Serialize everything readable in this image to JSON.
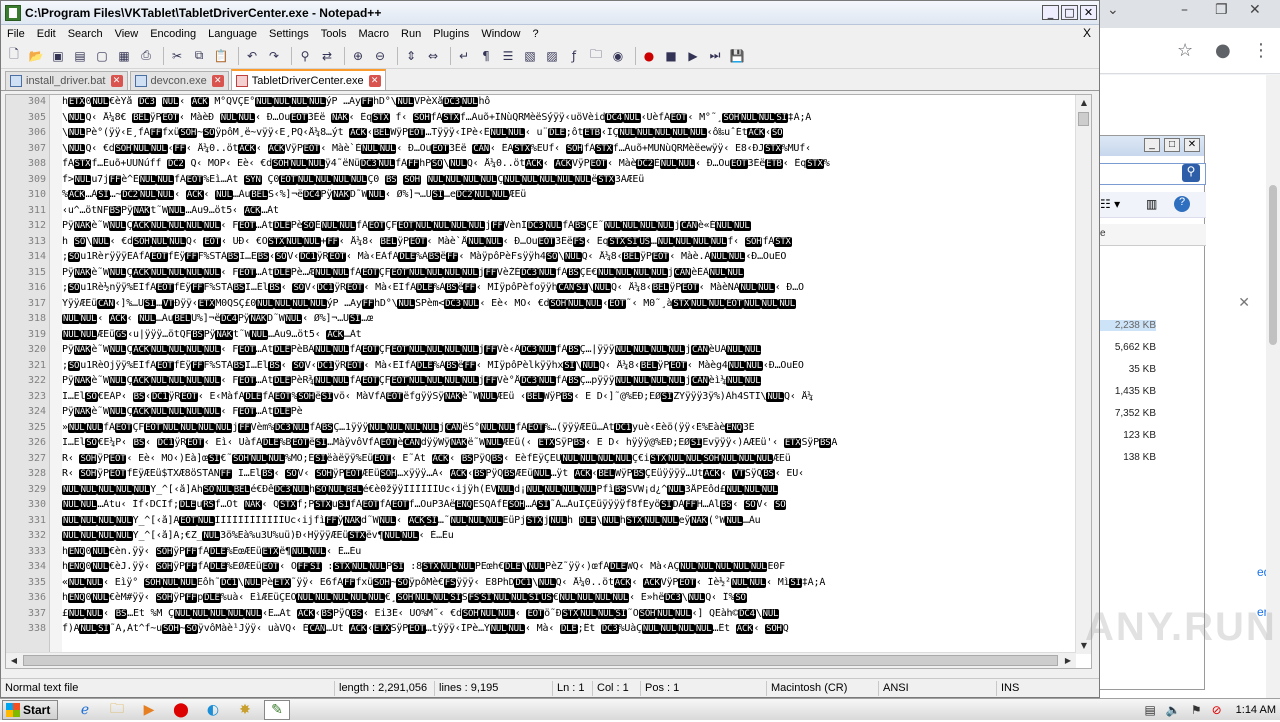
{
  "window": {
    "title": "C:\\Program Files\\VKTablet\\TabletDriverCenter.exe - Notepad++",
    "min": "_",
    "max": "□",
    "close": "✕"
  },
  "menu": [
    "File",
    "Edit",
    "Search",
    "View",
    "Encoding",
    "Language",
    "Settings",
    "Tools",
    "Macro",
    "Run",
    "Plugins",
    "Window",
    "?"
  ],
  "menu_close": "X",
  "toolbar_icons": [
    "new-file-icon",
    "open-file-icon",
    "save-icon",
    "save-all-icon",
    "close-icon",
    "close-all-icon",
    "print-icon",
    "cut-icon",
    "copy-icon",
    "paste-icon",
    "undo-icon",
    "redo-icon",
    "find-icon",
    "replace-icon",
    "zoom-in-icon",
    "zoom-out-icon",
    "sync-v-icon",
    "sync-h-icon",
    "wrap-icon",
    "show-all-icon",
    "indent-guide-icon",
    "udl-icon",
    "doc-map-icon",
    "function-list-icon",
    "folder-workspace-icon",
    "monitor-icon",
    "record-macro-icon",
    "stop-record-icon",
    "play-macro-icon",
    "run-macro-multiple-icon",
    "save-macro-icon"
  ],
  "tabs": [
    {
      "label": "install_driver.bat",
      "active": false
    },
    {
      "label": "devcon.exe",
      "active": false
    },
    {
      "label": "TabletDriverCenter.exe",
      "active": true
    }
  ],
  "editor": {
    "lines": [
      {
        "n": "304",
        "t": "hETX0NUL€èYå DC3 NUL‹ ACK M°QVÇE°NULNULNULNULýP  …ÄyFFhD°\\NULVPèXåDC3NULhô"
      },
      {
        "n": "305",
        "t": "\\NULQ‹ Å¼8€ BELÿPEOT‹ MàèÐ NULNUL‹ Ð…ÒuEOT3Éë NAK‹ ÊqSTX f‹ SOHfÀSTXf…Àuõ+ÎÑùQRMèëSýÿÿ‹uöVèidDC4NUL‹UèfÁEOT‹ M°˜¸SOHNULNULSI‡À;Á"
      },
      {
        "n": "306",
        "t": "\\NULPè°(ÿÿ‹E¸fÀFFfxüSOH~SOÿpôM¸ë~vÿÿ‹E¸PQ‹Å¼8…ýt ACK‹BELWÿPEOT…Tÿÿÿ‹ÌPè‹ÊNULNUL‹ u¨DLE;ôtETB‹ÎÇNULNULNULNULNUL‹ô‰uˆÉtACK‹SO"
      },
      {
        "n": "307",
        "t": "\\NULQ‹ €dSOHNULNUL‹FF‹ Å¼0..ötACK‹ ACKVÿPEOT‹ Màè`ÈNULNUL‹ Ð…ÒuEOT3Éë CAN‹ ÊASTX%EÜf‹ SOHfÀSTXf…Àuõ+MÜÑùQRMèëewÿÿ‹ E8‹ÐJSTX%MÜf‹"
      },
      {
        "n": "308",
        "t": "fÀSTXf…Éuõ+UÜÑúff DC2 Q‹ MÒP‹ Eè‹ €dSOHNULNULÿ4˜ëÑüDC3NULfÀFFhPSO\\NULQ‹ Å¼0..ötACK‹ ACKVÿPEOT‹ MàèDC2ÈNULNUL‹ Ð…ÒuEOT3ÉëETB‹ ÊqSTX%"
      },
      {
        "n": "309",
        "t": "f>NULu7jFFè^ÈNULNULfÀEOT%Eì…Àt SYN Ç0EOTNULNULNULNULÇ0 BS SOH NULNULNULNULÇNULNULNULNULNULëSTX3ÀÆEü"
      },
      {
        "n": "310",
        "t": "%ACK…ÀSI…~DC2NULNUL‹ ACK‹ NUL…ÀuBELS‹%]¬ëDC4PÿNAKD˜WNUL‹ Ø%]¬…ÜSI…eDC2NULNULÆEü"
      },
      {
        "n": "311",
        "t": "‹u^…ötNFBSPÿNAKt˜WNUL…Àu9…öt5‹ ACK…Àt"
      },
      {
        "n": "312",
        "t": "PÿNAKè˜WNULÇACKNULNULNULNUL‹ FEOT…ÀtDLEPèSOÉNULNULfÀEOTÇFEOTNULNULNULNULjFFVènÍDC3NULfÀBSÇE˜NULNULNULNULjCANè«ÉNULNUL"
      },
      {
        "n": "313",
        "t": "h SO\\NUL‹ €dSOHNULNULQ‹ EOT‹ UÐ‹ €ÔSTXNULNUL+FF‹ Å¼8‹ BELÿPEOT‹ Màè`ÅNULNUL‹ Ð…ÒuEOT3ÉëFS‹ ÊqSTXSIUS…NULNULNULNULf‹ SOHfÀSTX"
      },
      {
        "n": "314",
        "t": ";SOu1RèrÿÿÿEÀfÀEOTfÉÿFFF%STÀBSI…ËBS‹SOV‹DC1ÿREOT‹ Mà‹EÀfÀDLE%ÀBSëFF‹ MàÿpôPèFsÿÿh4SO\\NULQ‹ Å¼8‹BELÿPEOT‹ Màè.ÀNULNUL‹Ð…ÒuEO"
      },
      {
        "n": "315",
        "t": "PÿNAKè˜WNULÇACKNULNULNULNUL‹ FEOT…ÀtDLEPè…ÆNULNULfÀEOTÇFEOTNULNULNULNULjFFVèŽÉDC3NULfÀBSÇE€NULNULNULNULjCANèÈÂNULNUL"
      },
      {
        "n": "316",
        "t": ";SOu1Rè½nÿÿ%EÌfÀEOTfÉÿFFF%STÀBSI…ÉlBS‹ SOV‹DC1ÿREOT‹ Mà‹EÌfÀDLE%ÀBSëFF‹ MÌÿpôPèfoÿÿhCANSI\\NULQ‹ Å¼8‹BELÿPEOT‹ MàèNÀNULNUL‹ Ð…Ò"
      },
      {
        "n": "317",
        "t": "ŸÿÿÆEüCAN‹]%…ÜSI…VTÐÿÿ‹ETXM0QSÇ£0NULNULNULNULýP  …ÄyFFhD°\\NULSPèm<DC3NUL‹ Eè‹ MÔ‹ €dSOHNULNUL‹EOT˜‹ M0˜¸àSTXNULNULEOTNULNULNUL"
      },
      {
        "n": "318",
        "t": "NULNUL‹ ACK‹ NUL…ÀuBELÛ%]¬ëDC4PÿNAKD˜WNUL‹ Ø%]¬…ÜSI…œ"
      },
      {
        "n": "319",
        "t": "NULNULÆEüGS‹u|ÿÿÿ…ötQFBSPÿNAKt˜WNUL…Àu9…öt5‹ ACK…Àt"
      },
      {
        "n": "320",
        "t": "PÿNAKè˜WNULÇACKNULNULNULNUL‹ FEOT…ÀtDLEPèBÂNULNULfÀEOTÇFEOTNULNULNULNULjFFVè‹ÂDC3NULfÀBSÇ…|ÿÿÿNULNULNULNULjCANèUÁNULNUL"
      },
      {
        "n": "321",
        "t": ";SOu1RèOjÿÿ%EÌfÀEOTfÉÿFFF%STÀBSI…ÉlBS‹ SOV‹DC1ÿREOT‹ Mà‹EÌfÀDLE%ÀBSëFF‹ MÌÿpôPèlkÿÿhxSI\\NULQ‹ Å¼8‹BELÿPEOT‹ Màèg4NULNUL‹Ð…ÒuEO"
      },
      {
        "n": "322",
        "t": "PÿNAKè˜WNULÇACKNULNULNULNUL‹ FEOT…ÀtDLEPèR¾NULNULfÀEOTÇFEOTNULNULNULNULjFFVè°ÅDC3NULfÀBSÇ…pÿÿÿNULNULNULNULjCANèì¼NULNUL"
      },
      {
        "n": "323",
        "t": "I…ËlSO€EÀP‹ BS‹DC1ÿREOT‹ E‹MàfÀDLEfÀEOT%SOHëSIvö‹ MàVfÀEOTëfgÿÿSÿNAKè˜WNULÆEü ‹BELWÿPBS‹ E D‹]˜@%EÐ;EØSIZYÿÿÿ3ÿ%)Àh4STI\\NULQ‹ Å¼"
      },
      {
        "n": "324",
        "t": "PÿNAKè˜WNULÇACKNULNULNULNUL‹ FEOT…ÀtDLEPè"
      },
      {
        "n": "325",
        "t": "»NULNULfÀEOTÇFEOTNULNULNULNULjFFVèm%DC3NULfÀBSÇ…1ÿÿÿNULNULNULNULjCANëS°NULNULfÀEOT%…(ÿÿÿÆEü…ÀtDC1yuè‹Èèö(ÿÿ‹È%EàèENQ3É"
      },
      {
        "n": "326",
        "t": "I…ËlSO€E¼P‹ BS‹ DC1ÿREOT‹ Eì‹ UàfÀDLE%BEOTëSI…MàÿvôVfÀEOTèCANdÿÿWÿNAKë˜WNULÆEü(‹ ETXSÿPBS‹ E D‹ hÿÿÿ@%EÐ;EØSIEvÿÿÿ‹)ÀÆEü'‹ ETXSÿPBSA"
      },
      {
        "n": "327",
        "t": "R‹ SOHÿPEOT‹ Eè‹ MÔ‹)Èà]œSI€˜SOHNULNUL%MÔ;ÉSIëàëÿÿ%EüEOT‹ E˜Àt ACK‹ BSPÿQBS‹ EèfÉÿÇEÜNULNULNULNULÇ€iSTXNULNULSOHNULNULNULÆEü"
      },
      {
        "n": "328",
        "t": "R‹ SOHÿPEOTfÉÿÆEü$TXÆ8öSTÀNFF I…ËlBS‹ SOV‹ SOHÿPEOTÆEüSOH…xÿÿÿ…À‹ ACK‹BSPÿQBSÆEüNUL…ÿt ACK‹BELWÿPBSÇEüÿÿÿÿ…ÛtACK‹ VTSÿQBS‹ EÜ‹"
      },
      {
        "n": "329",
        "t": "NULNULNULNULNULY_^[‹å]ÃhSONULBELé€ÐêDC3NULhSONULBELé€è0žÿÿÌÌÌÌÌÌUc‹ijÿh(ÈVNULd¡NULNULNULNULPfìBSSVW¡d¿^NUL3ÅPEôd£NULNULNUL"
      },
      {
        "n": "330",
        "t": "NULNUL…Àtu‹ Ìf‹DCIf;DLEuRSf…Öt NAK‹ QSTXf;PSTXuSIfÀEOTfÀEOTf…ÖuP3ÀëENQESQÀfÉSOH…ÀSI˜À…ÀuIÇEüÿÿÿÿf8fÉyöSIDÀFFH…ÀlBS‹ SOV‹ SO"
      },
      {
        "n": "331",
        "t": "NULNULNULNULY_^[‹å]ÃEOTNULÌÌÌÌÌÌÌÌÌÌÌÌUc‹ijfìFFÿNAKd˜WNUL‹ ACKSI…˜NULNULNULEüPjSTXjNULh DLE\\NULhSTXNULNULeÿNAK(°WNUL…Àu"
      },
      {
        "n": "332",
        "t": "NULNULNULNULY_^[‹å]Ã;€Z_NUL3ö%Eà%u3Ü%uü)Ð‹HÿÿÿÆEüSTXëv¶NULNUL‹ È…Èu"
      },
      {
        "n": "333",
        "t": "hENQ0NUL€èn.ÿÿ‹ SOHÿPFFfÀDLE%EœÆEüETXë¶NULNUL‹ È…Èu"
      },
      {
        "n": "334",
        "t": "hENQ0NUL€èJ.ÿÿ‹ SOHÿPFFfÀDLE%EØÆEüEOT‹ OFFSI :STXNULNULPSI :8STXNULNULPEœh€DLE\\NULPèZ˜ÿÿ‹)œfÀDLEWQ‹ Mà‹ÄÇNULNULNULNULNULE0F"
      },
      {
        "n": "335",
        "t": "«NULNUL‹ Eìÿ° SOHNULNULEôh˜DC1\\NULPèETX˜ÿÿ‹ E6fÀFFfxüSOH~SOÿpôMè€FSÿÿÿ‹ E8PhDDC1\\NULQ‹ Å¼0..ötACK‹ ACKVÿPEOT‹ Îè½²NULNUL‹ MìSI‡À;Á"
      },
      {
        "n": "336",
        "t": "hENQ0NUL€èM#ÿÿ‹ SOHÿPFFpDLE%uà‹ EìÆEüÇEÔNULNULNULNULNUL€¸SOHNULNULSISFSSINULNULSIUS€NULNULNULNUL‹ E»hëDC3\\NULQ‹ Î%SO"
      },
      {
        "n": "337",
        "t": "£NULNUL‹ BS…Et  %M ÇNULNULNULNULNUL‹E…Àt ACK‹BSPÿQBS‹ Ei3É‹ UÖ%M˜‹ €dSOHNULNUL‹ EOTö˜ÐSTXNULNULSI˜ÕSOHNULNUL‹] QEàh©DC4\\NUL"
      },
      {
        "n": "338",
        "t": "f)ÃNULSI˜À,Àt^f~uSOH~SOÿvôMàè¹Jÿÿ‹ uàVQ‹ ÉCAN…Ût ACK‹ETXSÿPEOT…tÿÿÿ‹ÌPè…ÝNULNUL‹ Mà‹ DLE;Êt DC3%UàÇNULNULNULNUL…Êt ACK‹ SOHQ"
      }
    ]
  },
  "status": {
    "file_type": "Normal text file",
    "length": "length : 2,291,056",
    "lines": "lines : 9,195",
    "ln": "Ln : 1",
    "col": "Col : 1",
    "pos": "Pos : 1",
    "eol": "Macintosh (CR)",
    "encoding": "ANSI",
    "mode": "INS"
  },
  "taskbar": {
    "start": "Start",
    "items": [
      "ie-icon",
      "explorer-icon",
      "media-player-icon",
      "opera-icon",
      "edge-icon",
      "tablet-driver-icon",
      "notepad-plus-plus-icon"
    ],
    "clock": "1:14 AM"
  },
  "bg_dialog": {
    "sizes": [
      "2,238 KB",
      "5,662 KB",
      "35 KB",
      "1,435 KB",
      "7,352 KB",
      "123 KB",
      "138 KB"
    ],
    "col_fragment": "e"
  },
  "bg_browser_fragments": [
    "ed",
    "er"
  ],
  "watermark": "ANY.RUN"
}
